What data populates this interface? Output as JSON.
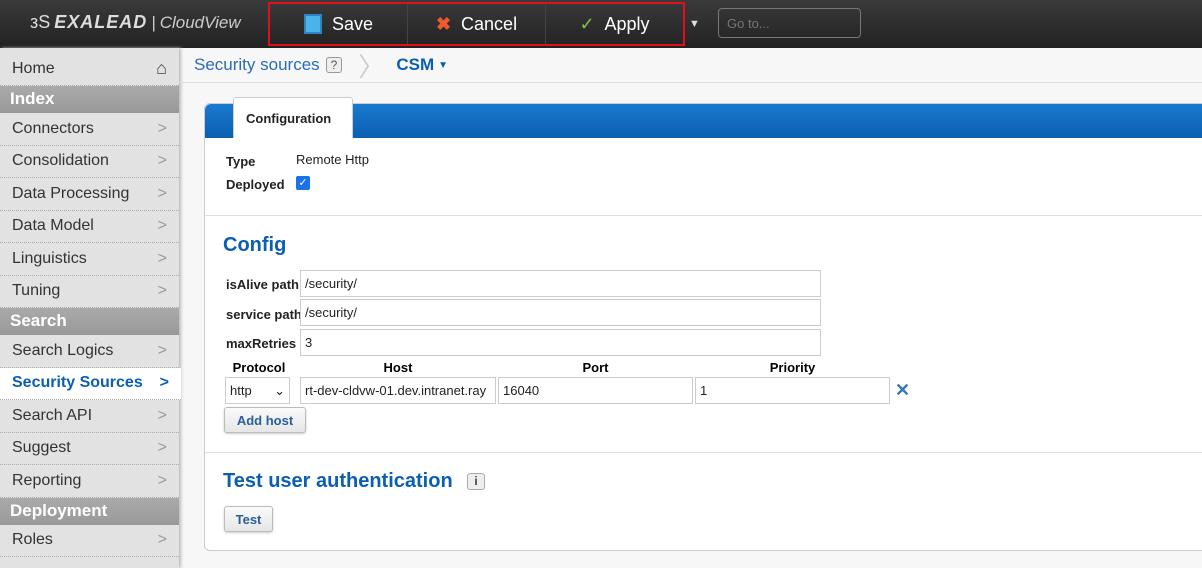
{
  "header": {
    "brand": "EXALEAD",
    "product": "CloudView",
    "save": "Save",
    "cancel": "Cancel",
    "apply": "Apply",
    "goto_placeholder": "Go to..."
  },
  "sidebar": {
    "home": "Home",
    "sections": [
      {
        "title": "Index",
        "items": [
          "Connectors",
          "Consolidation",
          "Data Processing",
          "Data Model",
          "Linguistics",
          "Tuning"
        ]
      },
      {
        "title": "Search",
        "items": [
          "Search Logics",
          "Security Sources",
          "Search API",
          "Suggest",
          "Reporting"
        ]
      },
      {
        "title": "Deployment",
        "items": [
          "Roles"
        ]
      }
    ],
    "active": "Security Sources"
  },
  "breadcrumb": {
    "parent": "Security sources",
    "help": "?",
    "current": "CSM"
  },
  "panel": {
    "tab": "Configuration",
    "type_label": "Type",
    "type_value": "Remote Http",
    "deployed_label": "Deployed",
    "deployed": true,
    "config_title": "Config",
    "fields": [
      {
        "label": "isAlive path",
        "value": "/security/"
      },
      {
        "label": "service path",
        "value": "/security/"
      },
      {
        "label": "maxRetries",
        "value": "3"
      }
    ],
    "hosts_headers": [
      "Protocol",
      "Host",
      "Port",
      "Priority"
    ],
    "host": {
      "protocol": "http",
      "host": "rt-dev-cldvw-01.dev.intranet.ray",
      "port": "16040",
      "priority": "1"
    },
    "add_host": "Add host",
    "test_title": "Test user authentication",
    "info": "i",
    "test": "Test"
  }
}
